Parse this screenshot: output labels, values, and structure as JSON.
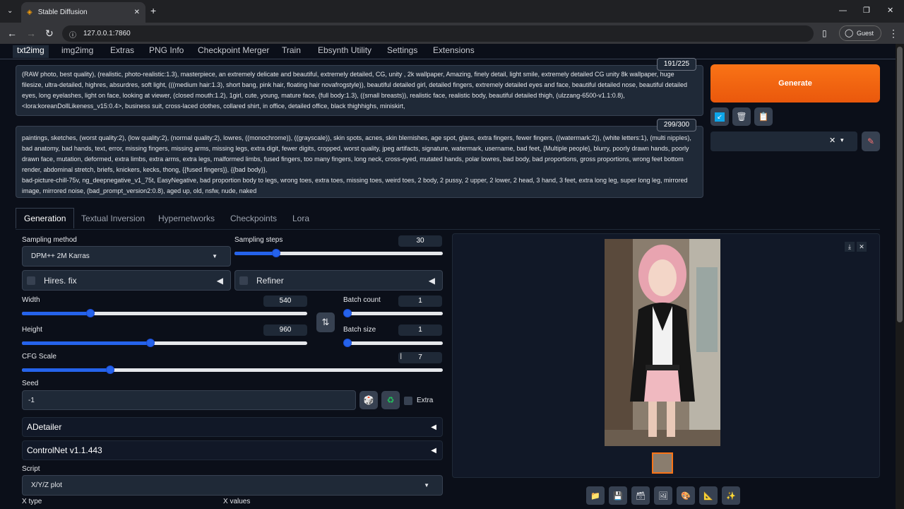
{
  "browser": {
    "tab_title": "Stable Diffusion",
    "url": "127.0.0.1:7860",
    "profile": "Guest"
  },
  "app_tabs": [
    "txt2img",
    "img2img",
    "Extras",
    "PNG Info",
    "Checkpoint Merger",
    "Train",
    "Ebsynth Utility",
    "Settings",
    "Extensions"
  ],
  "prompt": {
    "positive": "(RAW photo, best quality), (realistic, photo-realistic:1.3), masterpiece, an extremely delicate and beautiful, extremely detailed, CG, unity , 2k wallpaper, Amazing, finely detail, light smile, extremely detailed CG unity 8k wallpaper, huge filesize, ultra-detailed, highres, absurdres, soft light, (((medium hair:1.3), short bang, pink hair, floating hair novafrogstyle)), beautiful detailed girl, detailed fingers, extremely detailed eyes and face, beautiful detailed nose, beautiful detailed eyes, long eyelashes, light on face, looking at viewer, (closed mouth:1.2), 1girl, cute, young, mature face, (full body:1.3), ((small breasts)), realistic face, realistic body, beautiful detailed thigh, (ulzzang-6500-v1.1:0.8), <lora:koreanDollLikeness_v15:0.4>, business suit, cross-laced clothes, collared shirt, in office, detailed office, black thighhighs, miniskirt,",
    "positive_count": "191/225",
    "negative": "paintings, sketches, (worst quality:2), (low quality:2), (normal quality:2), lowres, ((monochrome)), ((grayscale)), skin spots, acnes, skin blemishes, age spot, glans, extra fingers, fewer fingers, ((watermark:2)), (white letters:1), (multi nipples), bad anatomy, bad hands, text, error, missing fingers, missing arms, missing legs, extra digit, fewer digits, cropped, worst quality, jpeg artifacts, signature, watermark, username, bad feet, {Multiple people}, blurry, poorly drawn hands, poorly drawn face, mutation, deformed, extra limbs, extra arms, extra legs, malformed limbs, fused fingers, too many fingers, long neck, cross-eyed, mutated hands, polar lowres, bad body, bad proportions, gross proportions, wrong feet bottom render, abdominal stretch, briefs, knickers, kecks, thong, {{fused fingers}}, {{bad body}},",
    "negative_line2": "bad-picture-chill-75v, ng_deepnegative_v1_75t, EasyNegative, bad proportion body to legs, wrong toes, extra toes, missing toes, weird toes, 2 body, 2 pussy, 2 upper, 2 lower, 2 head, 3 hand, 3 feet, extra long leg, super long leg, mirrored image, mirrored noise, (bad_prompt_version2:0.8), aged up, old, nsfw, nude, naked",
    "negative_count": "299/300"
  },
  "generate_label": "Generate",
  "sub_tabs": [
    "Generation",
    "Textual Inversion",
    "Hypernetworks",
    "Checkpoints",
    "Lora"
  ],
  "params": {
    "sampling_method_label": "Sampling method",
    "sampling_method": "DPM++ 2M Karras",
    "sampling_steps_label": "Sampling steps",
    "sampling_steps": "30",
    "sampling_steps_frac": 0.2,
    "hires_label": "Hires. fix",
    "refiner_label": "Refiner",
    "width_label": "Width",
    "width": "540",
    "width_frac": 0.24,
    "height_label": "Height",
    "height": "960",
    "height_frac": 0.45,
    "batch_count_label": "Batch count",
    "batch_count": "1",
    "batch_size_label": "Batch size",
    "batch_size": "1",
    "cfg_label": "CFG Scale",
    "cfg": "7",
    "cfg_frac": 0.21,
    "seed_label": "Seed",
    "seed": "-1",
    "extra_label": "Extra",
    "adetailer_label": "ADetailer",
    "controlnet_label": "ControlNet v1.1.443",
    "script_label": "Script",
    "script": "X/Y/Z plot",
    "x_type_label": "X type",
    "x_values_label": "X values"
  },
  "colors": {
    "accent": "#2563eb",
    "generate": "#ea580c",
    "bg": "#0b0f19"
  }
}
